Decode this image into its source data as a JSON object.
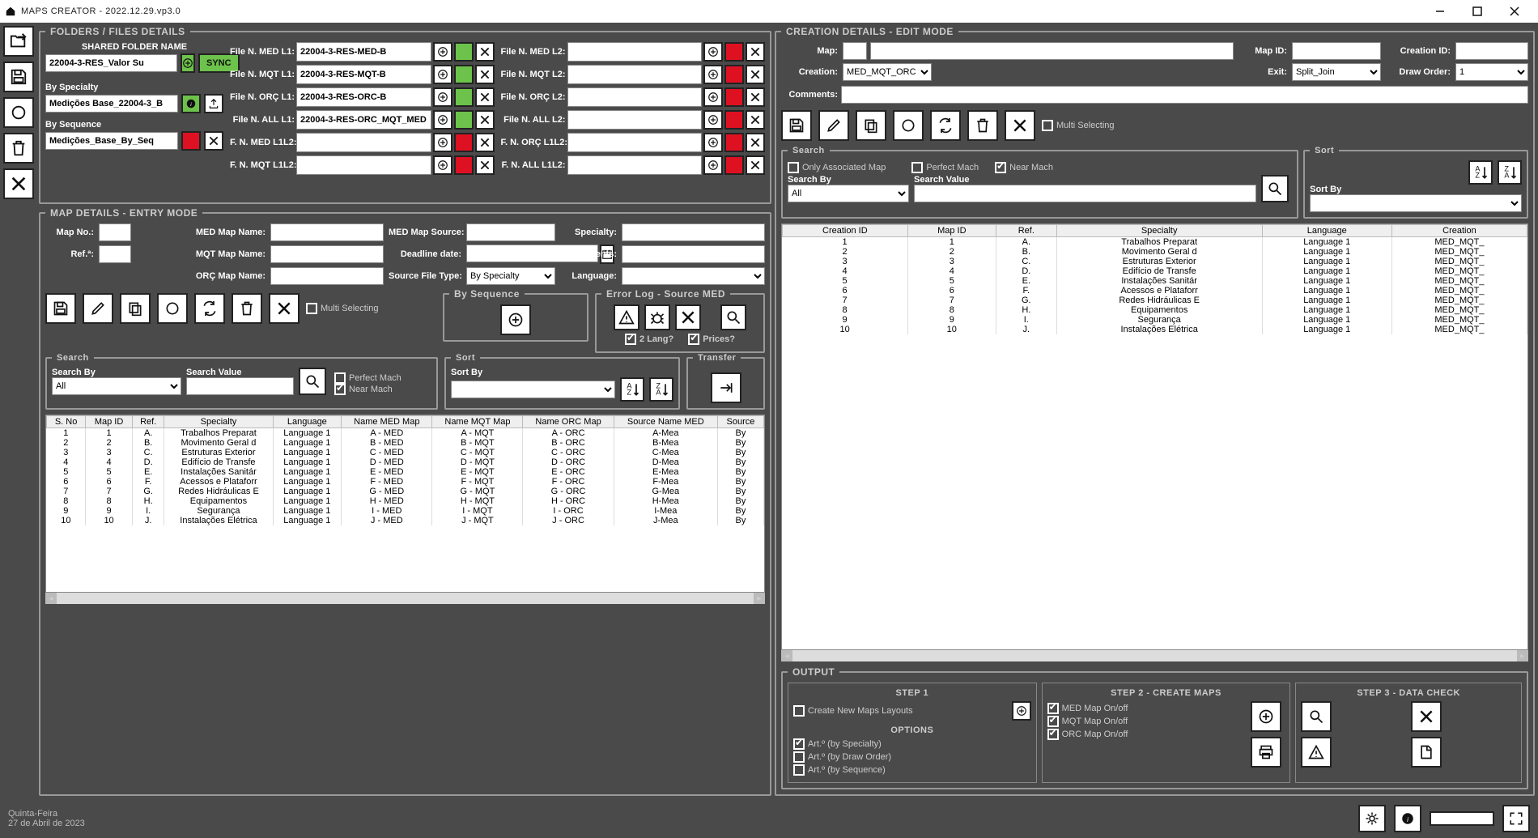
{
  "window": {
    "title": "MAPS CREATOR - 2022.12.29.vp3.0",
    "minimize": "—",
    "maximize": "□",
    "close": "✕"
  },
  "folders": {
    "legend": "FOLDERS / FILES DETAILS",
    "shared_label": "SHARED FOLDER NAME",
    "shared_value": "22004-3-RES_Valor Su",
    "sync": "SYNC",
    "by_specialty_label": "By Specialty",
    "by_specialty_value": "Medições Base_22004-3_B",
    "by_sequence_label": "By Sequence",
    "by_sequence_value": "Medições_Base_By_Seq",
    "col1_labels": [
      "File N. MED L1:",
      "File N. MQT L1:",
      "File N. ORÇ L1:",
      "File N. ALL L1:",
      "F. N. MED L1L2:",
      "F. N. MQT L1L2:"
    ],
    "col1_values": [
      "22004-3-RES-MED-B",
      "22004-3-RES-MQT-B",
      "22004-3-RES-ORC-B",
      "22004-3-RES-ORC_MQT_MED",
      "",
      ""
    ],
    "col2_labels": [
      "File N. MED L2:",
      "File N. MQT L2:",
      "File N. ORÇ L2:",
      "File N. ALL L2:",
      "F. N. ORÇ L1L2:",
      "F. N. ALL L1L2:"
    ],
    "col2_values": [
      "",
      "",
      "",
      "",
      "",
      ""
    ]
  },
  "mapdetails": {
    "legend": "MAP DETAILS - ENTRY MODE",
    "labels": {
      "map_no": "Map No.:",
      "med_name": "MED Map Name:",
      "med_source": "MED Map Source:",
      "specialty": "Specialty:",
      "refa": "Ref.ª:",
      "mqt_name": "MQT Map Name:",
      "deadline": "Deadline date:",
      "comments": "Comments:",
      "orc_name": "ORÇ Map Name:",
      "source_ft": "Source File Type:",
      "language": "Language:"
    },
    "source_ft_value": "By Specialty",
    "multi_selecting": "Multi Selecting",
    "errorlog": {
      "legend": "Error Log - Source MED",
      "two_lang": "2 Lang?",
      "prices": "Prices?"
    },
    "by_seq_legend": "By Sequence",
    "search": {
      "legend": "Search",
      "by": "Search By",
      "value": "Search Value",
      "all": "All",
      "perfect": "Perfect Mach",
      "near": "Near Mach"
    },
    "sort": {
      "legend": "Sort",
      "by": "Sort By"
    },
    "transfer": {
      "legend": "Transfer"
    },
    "table": {
      "headers": [
        "S. No",
        "Map ID",
        "Ref.",
        "Specialty",
        "Language",
        "Name MED Map",
        "Name MQT Map",
        "Name ORC Map",
        "Source Name MED",
        "Source"
      ],
      "rows": [
        [
          "1",
          "1",
          "A.",
          "Trabalhos Preparat",
          "Language 1",
          "A - MED",
          "A - MQT",
          "A - ORC",
          "A-Mea",
          "By"
        ],
        [
          "2",
          "2",
          "B.",
          "Movimento Geral d",
          "Language 1",
          "B - MED",
          "B - MQT",
          "B - ORC",
          "B-Mea",
          "By"
        ],
        [
          "3",
          "3",
          "C.",
          "Estruturas Exterior",
          "Language 1",
          "C - MED",
          "C - MQT",
          "C - ORC",
          "C-Mea",
          "By"
        ],
        [
          "4",
          "4",
          "D.",
          "Edifício de Transfe",
          "Language 1",
          "D - MED",
          "D - MQT",
          "D - ORC",
          "D-Mea",
          "By"
        ],
        [
          "5",
          "5",
          "E.",
          "Instalações Sanitár",
          "Language 1",
          "E - MED",
          "E - MQT",
          "E - ORC",
          "E-Mea",
          "By"
        ],
        [
          "6",
          "6",
          "F.",
          "Acessos e Plataforr",
          "Language 1",
          "F - MED",
          "F - MQT",
          "F - ORC",
          "F-Mea",
          "By"
        ],
        [
          "7",
          "7",
          "G.",
          "Redes Hidráulicas E",
          "Language 1",
          "G - MED",
          "G - MQT",
          "G - ORC",
          "G-Mea",
          "By"
        ],
        [
          "8",
          "8",
          "H.",
          "Equipamentos",
          "Language 1",
          "H - MED",
          "H - MQT",
          "H - ORC",
          "H-Mea",
          "By"
        ],
        [
          "9",
          "9",
          "I.",
          "Segurança",
          "Language 1",
          "I - MED",
          "I - MQT",
          "I - ORC",
          "I-Mea",
          "By"
        ],
        [
          "10",
          "10",
          "J.",
          "Instalações Elétrica",
          "Language 1",
          "J - MED",
          "J - MQT",
          "J - ORC",
          "J-Mea",
          "By"
        ]
      ]
    }
  },
  "creation": {
    "legend": "CREATION DETAILS - EDIT MODE",
    "labels": {
      "map": "Map:",
      "map_id": "Map ID:",
      "creation_id": "Creation ID:",
      "creation": "Creation:",
      "exit": "Exit:",
      "draw_order": "Draw Order:",
      "comments": "Comments:"
    },
    "creation_value": "MED_MQT_ORC",
    "exit_value": "Split_Join",
    "draw_order_value": "1",
    "multi_selecting": "Multi Selecting",
    "search": {
      "legend": "Search",
      "only_assoc": "Only Associated Map",
      "perfect": "Perfect Mach",
      "near": "Near Mach",
      "by": "Search By",
      "all": "All",
      "value": "Search Value"
    },
    "sort": {
      "legend": "Sort",
      "by": "Sort By"
    },
    "table": {
      "headers": [
        "Creation ID",
        "Map ID",
        "Ref.",
        "Specialty",
        "Language",
        "Creation"
      ],
      "rows": [
        [
          "1",
          "1",
          "A.",
          "Trabalhos Preparat",
          "Language 1",
          "MED_MQT_"
        ],
        [
          "2",
          "2",
          "B.",
          "Movimento Geral d",
          "Language 1",
          "MED_MQT_"
        ],
        [
          "3",
          "3",
          "C.",
          "Estruturas Exterior",
          "Language 1",
          "MED_MQT_"
        ],
        [
          "4",
          "4",
          "D.",
          "Edifício de Transfe",
          "Language 1",
          "MED_MQT_"
        ],
        [
          "5",
          "5",
          "E.",
          "Instalações Sanitár",
          "Language 1",
          "MED_MQT_"
        ],
        [
          "6",
          "6",
          "F.",
          "Acessos e Plataforr",
          "Language 1",
          "MED_MQT_"
        ],
        [
          "7",
          "7",
          "G.",
          "Redes Hidráulicas E",
          "Language 1",
          "MED_MQT_"
        ],
        [
          "8",
          "8",
          "H.",
          "Equipamentos",
          "Language 1",
          "MED_MQT_"
        ],
        [
          "9",
          "9",
          "I.",
          "Segurança",
          "Language 1",
          "MED_MQT_"
        ],
        [
          "10",
          "10",
          "J.",
          "Instalações Elétrica",
          "Language 1",
          "MED_MQT_"
        ]
      ]
    }
  },
  "output": {
    "legend": "OUTPUT",
    "step1": "STEP 1",
    "step2": "STEP 2 - CREATE MAPS",
    "step3": "STEP 3 - DATA CHECK",
    "create_new": "Create New Maps Layouts",
    "options": "OPTIONS",
    "art_spec": "Art.º (by Specialty)",
    "art_draw": "Art.º (by Draw Order)",
    "art_seq": "Art.º (by Sequence)",
    "med_on": "MED Map On/off",
    "mqt_on": "MQT Map On/off",
    "orc_on": "ORC Map On/off"
  },
  "footer": {
    "weekday": "Quinta-Feira",
    "date": "27 de Abril de 2023"
  }
}
